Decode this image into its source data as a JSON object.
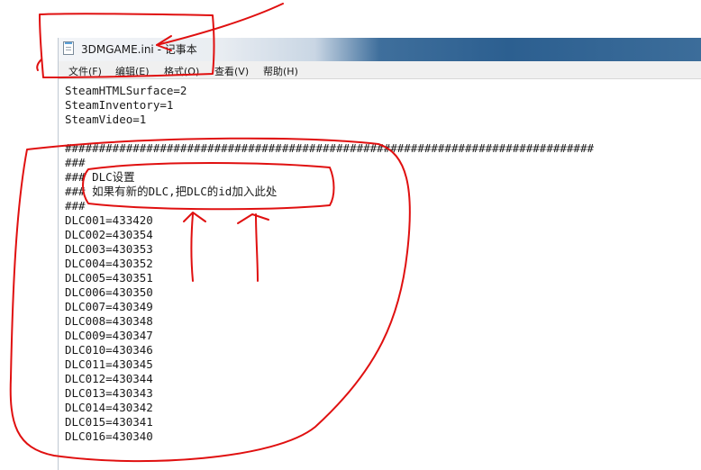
{
  "window": {
    "title": "3DMGAME.ini - 记事本"
  },
  "menu": [
    {
      "label": "文件(F)"
    },
    {
      "label": "编辑(E)"
    },
    {
      "label": "格式(O)"
    },
    {
      "label": "查看(V)"
    },
    {
      "label": "帮助(H)"
    }
  ],
  "editor": {
    "lines": [
      "SteamHTMLSurface=2",
      "SteamInventory=1",
      "SteamVideo=1",
      "",
      "##############################################################################",
      "###",
      "### DLC设置",
      "### 如果有新的DLC,把DLC的id加入此处",
      "###",
      "DLC001=433420",
      "DLC002=430354",
      "DLC003=430353",
      "DLC004=430352",
      "DLC005=430351",
      "DLC006=430350",
      "DLC007=430349",
      "DLC008=430348",
      "DLC009=430347",
      "DLC010=430346",
      "DLC011=430345",
      "DLC012=430344",
      "DLC013=430343",
      "DLC014=430342",
      "DLC015=430341",
      "DLC016=430340"
    ]
  },
  "colors": {
    "annotation": "#e01010",
    "titlebar_accent": "#2c5f90",
    "menubar_bg": "#f0f0f0"
  }
}
